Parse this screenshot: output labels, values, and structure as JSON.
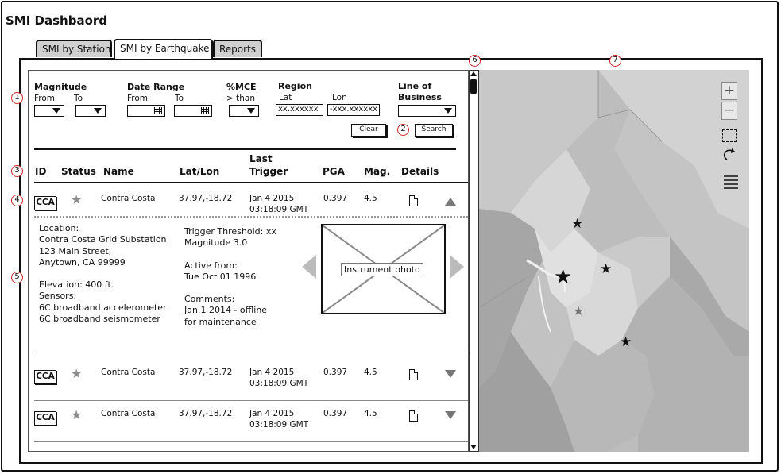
{
  "app": {
    "title": "SMI Dashbaord"
  },
  "tabs": [
    {
      "label": "SMI by Station"
    },
    {
      "label": "SMI by Earthquake"
    },
    {
      "label": "Reports"
    }
  ],
  "callouts": [
    "1",
    "2",
    "3",
    "4",
    "5",
    "6",
    "7"
  ],
  "filters": {
    "magnitude": {
      "label": "Magnitude",
      "from": "From",
      "to": "To"
    },
    "date_range": {
      "label": "Date Range",
      "from": "From",
      "to": "To"
    },
    "mce": {
      "label": "%MCE",
      "sub": "> than"
    },
    "region": {
      "label": "Region",
      "lat_label": "Lat",
      "lon_label": "Lon",
      "lat_value": "xx.xxxxxx",
      "lon_value": "-xxx.xxxxxx"
    },
    "line_of_business": {
      "label_line1": "Line of",
      "label_line2": "Business"
    },
    "clear_label": "Clear",
    "search_label": "Search"
  },
  "table": {
    "headers": {
      "id": "ID",
      "status": "Status",
      "name": "Name",
      "latlon": "Lat/Lon",
      "last_trigger_1": "Last",
      "last_trigger_2": "Trigger",
      "pga": "PGA",
      "mag": "Mag.",
      "details": "Details"
    },
    "rows": [
      {
        "id": "CCA",
        "name": "Contra Costa",
        "latlon": "37.97,-18.72",
        "date": "Jan 4 2015",
        "time": "03:18:09 GMT",
        "pga": "0.397",
        "mag": "4.5"
      },
      {
        "id": "CCA",
        "name": "Contra Costa",
        "latlon": "37.97,-18.72",
        "date": "Jan 4 2015",
        "time": "03:18:09 GMT",
        "pga": "0.397",
        "mag": "4.5"
      },
      {
        "id": "CCA",
        "name": "Contra Costa",
        "latlon": "37.97,-18.72",
        "date": "Jan 4 2015",
        "time": "03:18:09 GMT",
        "pga": "0.397",
        "mag": "4.5"
      }
    ]
  },
  "detail": {
    "location_label": "Location:",
    "location_name": "Contra Costa Grid Substation",
    "address1": "123 Main Street,",
    "address2": "Anytown, CA 99999",
    "elevation": "Elevation: 400 ft.",
    "sensors_label": "Sensors:",
    "sensor1": "6C broadband accelerometer",
    "sensor2": "6C broadband seismometer",
    "trigger_threshold": "Trigger Threshold: xx",
    "trigger_magnitude": "Magnitude 3.0",
    "active_from_label": "Active from:",
    "active_from_value": "Tue Oct 01 1996",
    "comments_label": "Comments:",
    "comments_1": "Jan 1 2014 - offline",
    "comments_2": "for maintenance",
    "photo_label": "Instrument photo"
  },
  "map": {
    "zoom_in": "+",
    "zoom_out": "−"
  }
}
